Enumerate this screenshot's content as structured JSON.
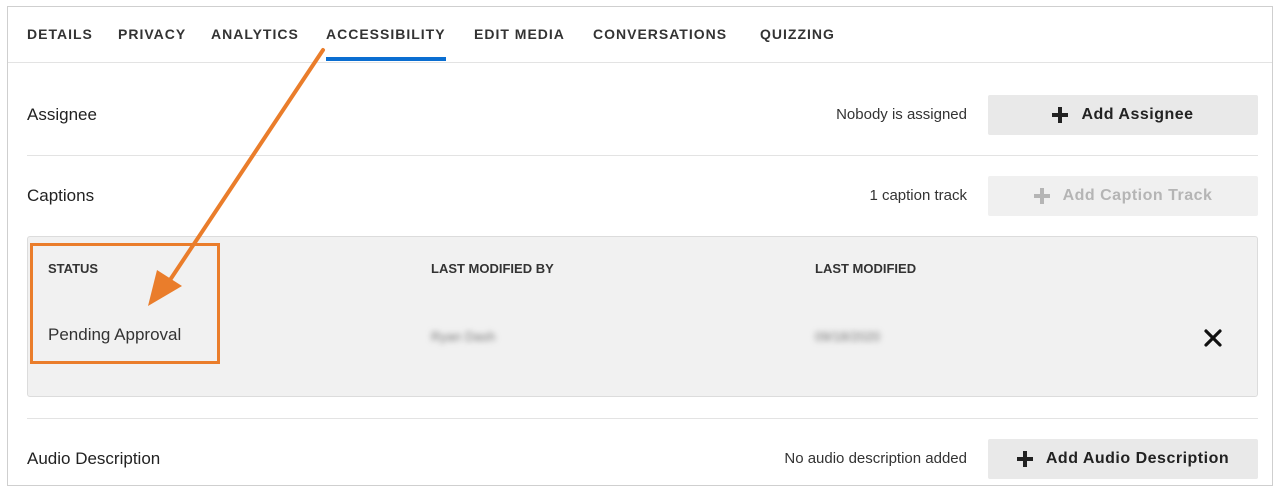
{
  "tabs": [
    {
      "label": "DETAILS"
    },
    {
      "label": "PRIVACY"
    },
    {
      "label": "ANALYTICS"
    },
    {
      "label": "ACCESSIBILITY",
      "active": true
    },
    {
      "label": "EDIT MEDIA"
    },
    {
      "label": "CONVERSATIONS"
    },
    {
      "label": "QUIZZING"
    }
  ],
  "assignee": {
    "label": "Assignee",
    "status": "Nobody is assigned",
    "button": "Add Assignee"
  },
  "captions": {
    "label": "Captions",
    "status": "1 caption track",
    "button": "Add Caption Track",
    "table": {
      "headers": [
        "STATUS",
        "LAST MODIFIED BY",
        "LAST MODIFIED"
      ],
      "row": {
        "status": "Pending Approval",
        "modified_by": "Ryan Dash",
        "modified": "09/18/2020"
      }
    }
  },
  "audio_description": {
    "label": "Audio Description",
    "status": "No audio description added",
    "button": "Add Audio Description"
  },
  "colors": {
    "active_tab_underline": "#0a6ed1",
    "annotation": "#ea7d2b",
    "button_bg": "#e9e9e9"
  },
  "icons": [
    "plus-icon",
    "close-icon",
    "arrow-annotation"
  ]
}
